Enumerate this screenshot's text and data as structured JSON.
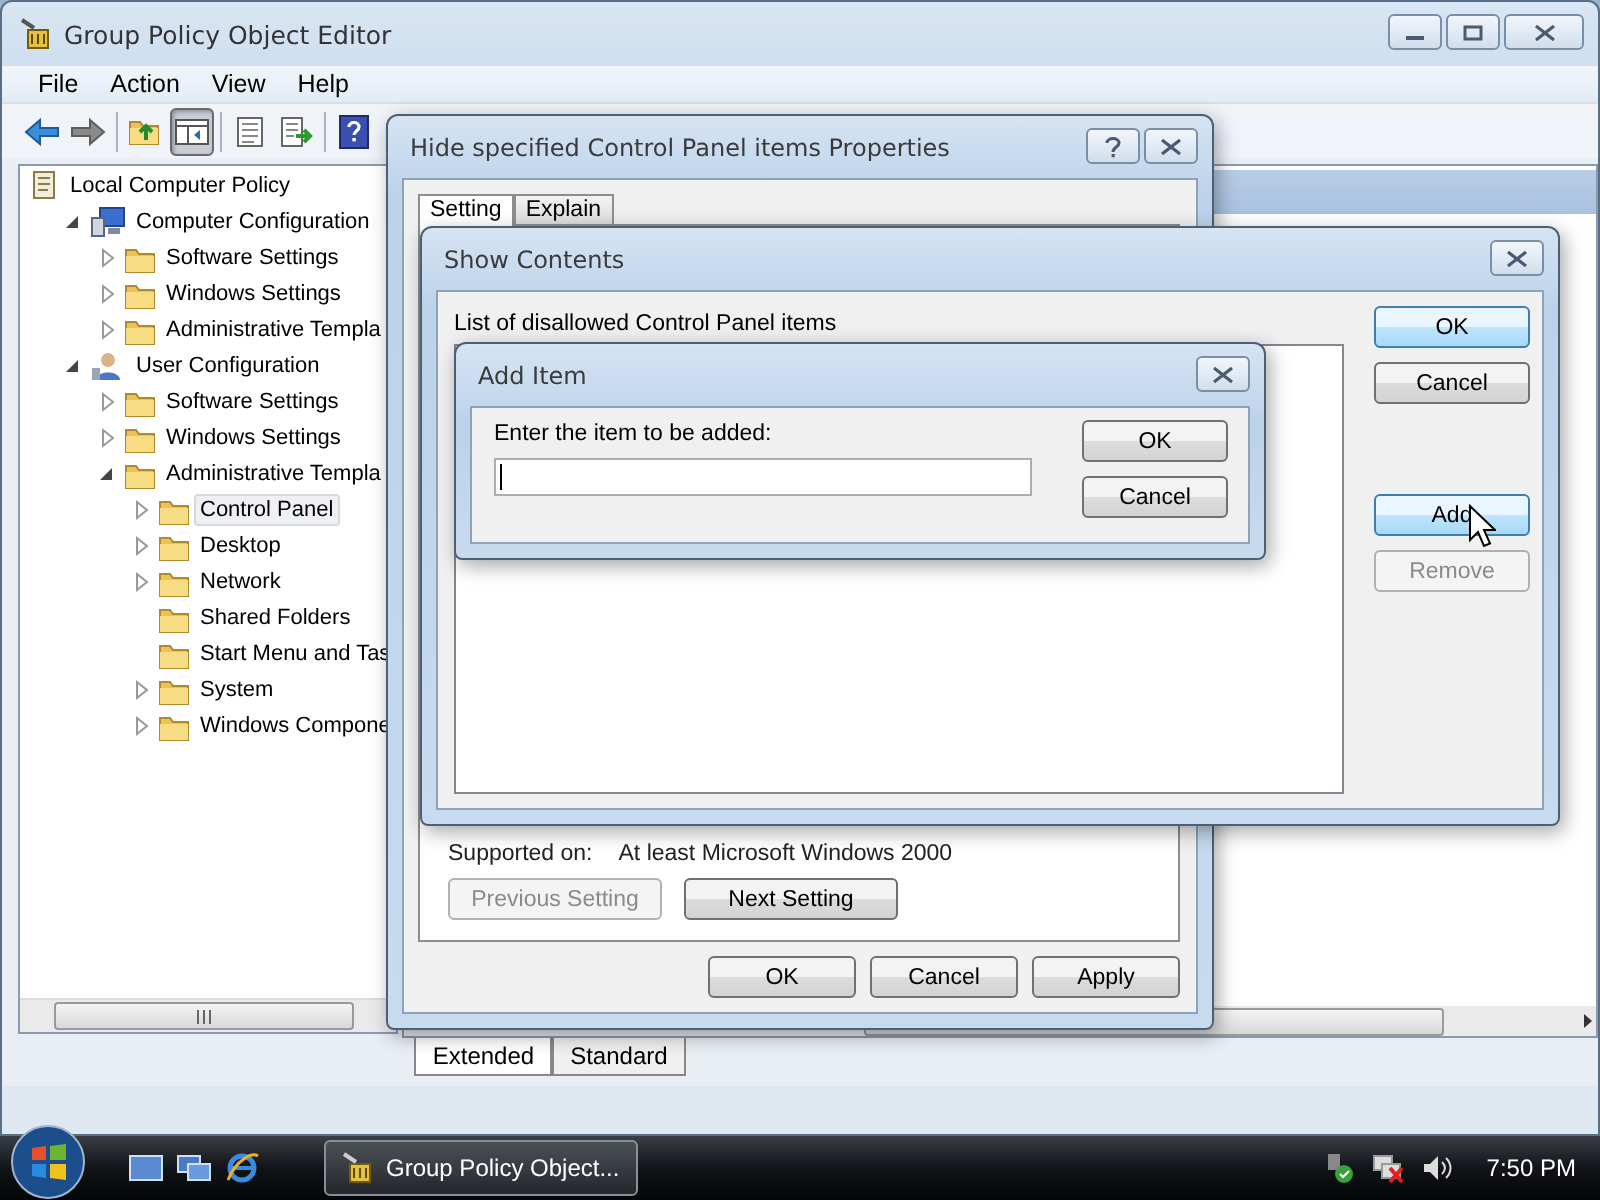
{
  "window": {
    "title": "Group Policy Object Editor"
  },
  "menu": [
    "File",
    "Action",
    "View",
    "Help"
  ],
  "toolbar": [
    {
      "kind": "back",
      "pressed": false
    },
    {
      "kind": "forward",
      "pressed": false
    },
    {
      "kind": "separator"
    },
    {
      "kind": "up",
      "pressed": false
    },
    {
      "kind": "tree",
      "pressed": true
    },
    {
      "kind": "separator"
    },
    {
      "kind": "properties",
      "pressed": false
    },
    {
      "kind": "export",
      "pressed": false
    },
    {
      "kind": "separator"
    },
    {
      "kind": "help",
      "pressed": false
    }
  ],
  "tree": [
    {
      "label": "Local Computer Policy",
      "kind": "policy",
      "selected": false,
      "children": [
        {
          "label": "Computer Configuration",
          "kind": "computer",
          "expanded": true,
          "selected": false,
          "children": [
            {
              "label": "Software Settings",
              "kind": "folder",
              "expanded": false,
              "selected": false
            },
            {
              "label": "Windows Settings",
              "kind": "folder",
              "expanded": false,
              "selected": false
            },
            {
              "label": "Administrative Templa",
              "kind": "folder",
              "expanded": false,
              "selected": false
            }
          ]
        },
        {
          "label": "User Configuration",
          "kind": "user",
          "expanded": true,
          "selected": false,
          "children": [
            {
              "label": "Software Settings",
              "kind": "folder",
              "expanded": false,
              "selected": false
            },
            {
              "label": "Windows Settings",
              "kind": "folder",
              "expanded": false,
              "selected": false
            },
            {
              "label": "Administrative Templa",
              "kind": "folder",
              "expanded": true,
              "selected": false,
              "children": [
                {
                  "label": "Control Panel",
                  "kind": "folder",
                  "expanded": false,
                  "selected": true
                },
                {
                  "label": "Desktop",
                  "kind": "folder",
                  "expanded": false,
                  "selected": false
                },
                {
                  "label": "Network",
                  "kind": "folder",
                  "expanded": false,
                  "selected": false
                },
                {
                  "label": "Shared Folders",
                  "kind": "folder",
                  "selected": false
                },
                {
                  "label": "Start Menu and Tas",
                  "kind": "folder",
                  "selected": false
                },
                {
                  "label": "System",
                  "kind": "folder",
                  "expanded": false,
                  "selected": false
                },
                {
                  "label": "Windows Compone",
                  "kind": "folder",
                  "expanded": false,
                  "selected": false
                }
              ]
            }
          ]
        }
      ]
    }
  ],
  "view_tabs": [
    {
      "label": "Extended",
      "selected": true
    },
    {
      "label": "Standard",
      "selected": false
    }
  ],
  "properties_dialog": {
    "title": "Hide specified Control Panel items Properties",
    "tabs": [
      {
        "label": "Setting",
        "selected": true
      },
      {
        "label": "Explain",
        "selected": false
      }
    ],
    "supported_on_label": "Supported on:",
    "supported_on": "At least Microsoft Windows 2000",
    "nav_buttons": [
      {
        "label": "Previous Setting",
        "disabled": true
      },
      {
        "label": "Next Setting",
        "disabled": false
      }
    ],
    "buttons": [
      {
        "label": "OK",
        "disabled": false
      },
      {
        "label": "Cancel",
        "disabled": false
      },
      {
        "label": "Apply",
        "disabled": false
      }
    ]
  },
  "show_contents_dialog": {
    "title": "Show Contents",
    "list_label": "List of disallowed Control Panel items",
    "buttons": [
      {
        "label": "OK",
        "default": true,
        "hover": false,
        "disabled": false
      },
      {
        "label": "Cancel",
        "default": false,
        "hover": false,
        "disabled": false
      }
    ],
    "item_buttons": [
      {
        "label": "Add",
        "default": false,
        "hover": true,
        "disabled": false
      },
      {
        "label": "Remove",
        "default": false,
        "hover": false,
        "disabled": true
      }
    ]
  },
  "add_item_dialog": {
    "title": "Add Item",
    "prompt": "Enter the item to be added:",
    "focused": true,
    "buttons": [
      {
        "label": "OK",
        "disabled": false
      },
      {
        "label": "Cancel",
        "disabled": false
      }
    ]
  },
  "taskbar": {
    "tasks": [
      {
        "label": "Group Policy Object...",
        "active": true
      }
    ],
    "clock": "7:50 PM"
  }
}
